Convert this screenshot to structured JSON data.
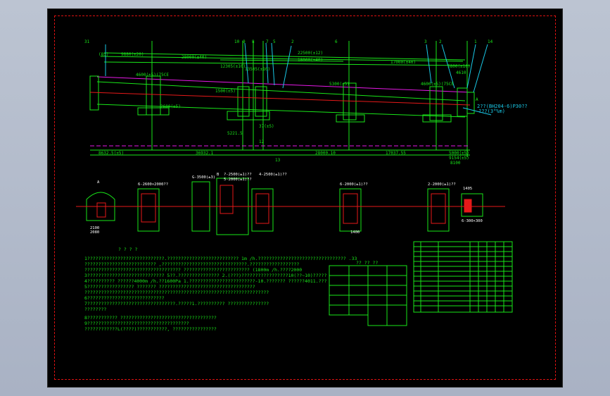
{
  "colors": {
    "background": "#000000",
    "green": "#19e619",
    "red": "#e61919",
    "magenta": "#e619e6",
    "yellow": "#e6e619",
    "cyan": "#19c8e6",
    "white": "#ffffff"
  },
  "elevation": {
    "callouts": [
      "31",
      "10",
      "9",
      "8",
      "7",
      "5",
      "2",
      "6",
      "3",
      "2",
      "1",
      "14",
      "12",
      "13",
      "A"
    ],
    "dims_top": [
      "(85)",
      "9880(±20)",
      "28000(±40)",
      "12305(±10)",
      "13505(±10)",
      "22500(±12)",
      "18000(±40)",
      "17000(±40)",
      "5800(±10)",
      "4610"
    ],
    "dims_bottom": [
      "8632.5(±5)",
      "36932.1",
      "28000.10",
      "17037.55",
      "5000(±5)",
      "9154(±5)",
      "8100"
    ],
    "side_note": "2??(BH204-6)P30??",
    "side_note2": "???(3°%m)",
    "notes": [
      "4600(±5)(75CE",
      "5300(±5)",
      "4600(±5)(75CE",
      "2600(±5)",
      "1500(±5)",
      "5221.5",
      "37(±5)"
    ]
  },
  "sections": {
    "a_label": "A",
    "b_label": "B",
    "labels": [
      "6-2600×2000??",
      "G-3500(±3)",
      "?-2500(±1)??",
      "5-2000(±1)??",
      "4-2500(±1)??",
      "6-2000(±1)??",
      "2-2000(±1)??",
      "6-300×300",
      "2100",
      "2080",
      "1400",
      "1405"
    ]
  },
  "tech_req": {
    "title": "? ? ? ?",
    "lines": [
      "1????????????????????????????.?????????????????????????? 1m /h.???????????????????????????????? .33",
      "  ?????????????????????????? ,???????????????????????????????.??????????????????",
      "  ???????????????????????????????????       ???????????????????????? (1800m /h.????2000",
      "3???????????????????????????? 5??.???????????????    2.(???)?????????????????10(??~10)?????",
      "4??????????  ??????4000m /h.??1600Pa        1.????????????????????????-10.??????? ??????4011.???",
      "5????????????????? ??????? ???????????????????????????????????",
      "  ???????????????????????????????????????????????????????????????????",
      "6????????????????????????????",
      "7????????????????????????????????.?????1.?????????? ???????????????",
      "  ????????",
      "8??????????? ???????????????????????????????????",
      "9?????????????????????????????????????",
      "  ????????????L(????)???????????, ????????????????"
    ]
  },
  "spec_table": {
    "title": "?? ?? ??",
    "rows": 14,
    "cols": 4
  },
  "parts_list": {
    "rows": 18,
    "cols": 8
  }
}
